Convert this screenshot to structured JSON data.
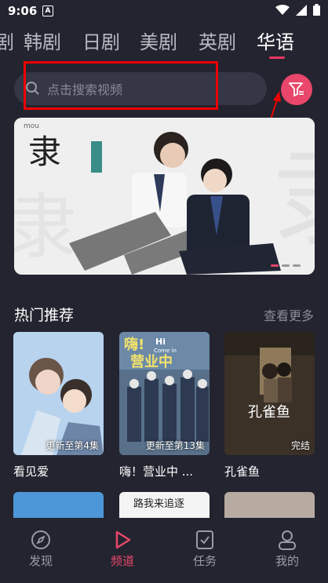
{
  "status": {
    "time": "9:06",
    "notify_letter": "A"
  },
  "tabs": [
    {
      "label": "剧"
    },
    {
      "label": "韩剧"
    },
    {
      "label": "日剧"
    },
    {
      "label": "美剧"
    },
    {
      "label": "英剧"
    },
    {
      "label": "华语"
    }
  ],
  "search": {
    "placeholder": "点击搜索视频"
  },
  "banner": {
    "title_text": "隶",
    "credit_text": "mou",
    "dots": 3,
    "active_dot": 0
  },
  "hot": {
    "title": "热门推荐",
    "more": "查看更多",
    "items": [
      {
        "title": "看见爱",
        "badge": "更新至第4集",
        "color": "#a9c7e6"
      },
      {
        "title": "嗨！营业中 ...",
        "badge": "更新至第13集",
        "color": "#5b6f8a"
      },
      {
        "title": "孔雀鱼",
        "badge": "完结",
        "color": "#3f3529"
      }
    ],
    "poster_texts": [
      "嗨!",
      "Hi",
      "Come in",
      "营业中",
      "孔雀鱼"
    ],
    "second_row": [
      {
        "color": "#4d97d8",
        "text": ""
      },
      {
        "color": "#f4f4f4",
        "text": "路我来追逐"
      },
      {
        "color": "#b7aaa0",
        "text": ""
      }
    ]
  },
  "nav": [
    {
      "label": "发现",
      "icon": "compass-icon"
    },
    {
      "label": "频道",
      "icon": "play-icon"
    },
    {
      "label": "任务",
      "icon": "task-icon"
    },
    {
      "label": "我的",
      "icon": "user-icon"
    }
  ],
  "colors": {
    "background": "#23242f",
    "accent": "#e8466a",
    "highlight": "#e00000"
  }
}
